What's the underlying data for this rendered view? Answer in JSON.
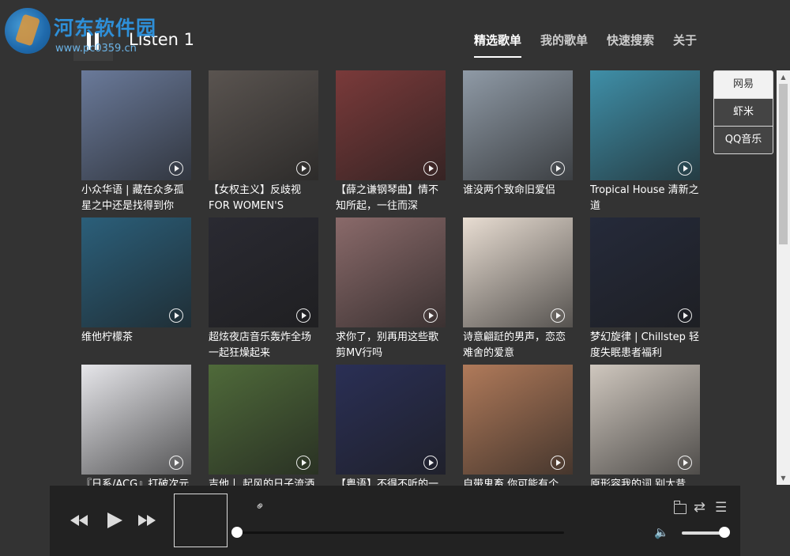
{
  "watermark": {
    "title": "河东软件园",
    "url": "www.pc0359.cn"
  },
  "app": {
    "title": "Listen 1"
  },
  "nav": [
    {
      "label": "精选歌单",
      "active": true
    },
    {
      "label": "我的歌单",
      "active": false
    },
    {
      "label": "快速搜索",
      "active": false
    },
    {
      "label": "关于",
      "active": false
    }
  ],
  "sources": [
    {
      "label": "网易",
      "active": true
    },
    {
      "label": "虾米",
      "active": false
    },
    {
      "label": "QQ音乐",
      "active": false
    }
  ],
  "playlists": [
    {
      "title": "小众华语 | 藏在众多孤星之中还是找得到你",
      "color": "#6a7a9a"
    },
    {
      "title": "【女权主义】反歧视 FOR WOMEN'S MARCH",
      "color": "#5a5450"
    },
    {
      "title": "【薛之谦钢琴曲】情不知所起，一往而深",
      "color": "#7a3a3a"
    },
    {
      "title": "谁没两个致命旧爱侣",
      "color": "#8f9aa6"
    },
    {
      "title": "Tropical House 清新之道",
      "color": "#3f8fa8"
    },
    {
      "title": "维他柠檬茶",
      "color": "#2b5f7a"
    },
    {
      "title": "超炫夜店音乐轰炸全场 一起狂燥起来",
      "color": "#2a2a32"
    },
    {
      "title": "求你了，别再用这些歌剪MV行吗",
      "color": "#8a6a6a"
    },
    {
      "title": "诗意翩跹的男声，恋恋难舍的爱意",
      "color": "#e8ddd2"
    },
    {
      "title": "梦幻旋律 | Chillstep 轻度失眠患者福利",
      "color": "#252a3a"
    },
    {
      "title": "『日系/ACG』打破次元的壁",
      "color": "#e6e6ea"
    },
    {
      "title": "吉他丨 起风的日子流洒",
      "color": "#4f6a3a"
    },
    {
      "title": "【粤语】不得不听的一",
      "color": "#2a2f55"
    },
    {
      "title": "自带鬼畜 你可能有个",
      "color": "#b07a5a"
    },
    {
      "title": "原形容我的词 别太昔",
      "color": "#cfc7be"
    }
  ],
  "player": {
    "progress": 0,
    "volume": 1.0
  },
  "icons": {
    "prev": "prev-icon",
    "play": "play-icon",
    "next": "next-icon",
    "link": "link-icon",
    "folder": "folder-icon",
    "repeat": "repeat-icon",
    "list": "list-icon",
    "volume": "volume-icon"
  }
}
